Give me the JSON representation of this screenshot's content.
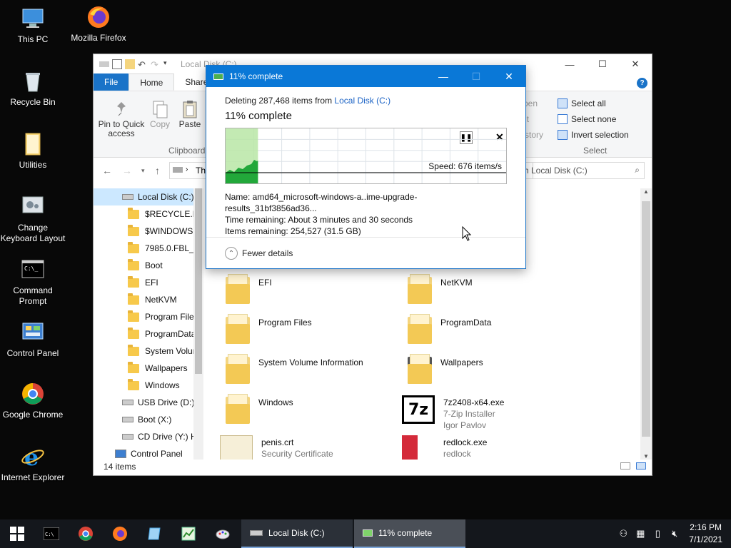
{
  "desktop": {
    "icons": [
      {
        "label": "This PC"
      },
      {
        "label": "Mozilla Firefox"
      },
      {
        "label": "Recycle Bin"
      },
      {
        "label": "Utilities"
      },
      {
        "label": "Change Keyboard Layout"
      },
      {
        "label": "Command Prompt"
      },
      {
        "label": "Control Panel"
      },
      {
        "label": "Google Chrome"
      },
      {
        "label": "Internet Explorer"
      }
    ]
  },
  "explorer": {
    "title": "Local Disk (C:)",
    "tabs": [
      "File",
      "Home",
      "Share"
    ],
    "ribbon": {
      "pin": "Pin to Quick access",
      "copy": "Copy",
      "paste": "Paste",
      "clipboard": "Clipboard",
      "open_partial": "pen",
      "edit_partial": "it",
      "history_partial": "story",
      "select_all": "Select all",
      "select_none": "Select none",
      "invert_selection": "Invert selection",
      "select_group": "Select"
    },
    "address": "Th",
    "search_placeholder": "h Local Disk (C:)",
    "tree": [
      {
        "label": "Local Disk (C:)",
        "type": "drive"
      },
      {
        "label": "$RECYCLE.BIN",
        "type": "folder"
      },
      {
        "label": "$WINDOWS.~",
        "type": "folder"
      },
      {
        "label": "7985.0.FBL_GI",
        "type": "folder"
      },
      {
        "label": "Boot",
        "type": "folder"
      },
      {
        "label": "EFI",
        "type": "folder"
      },
      {
        "label": "NetKVM",
        "type": "folder"
      },
      {
        "label": "Program Files",
        "type": "folder"
      },
      {
        "label": "ProgramData",
        "type": "folder"
      },
      {
        "label": "System Volun",
        "type": "folder"
      },
      {
        "label": "Wallpapers",
        "type": "folder"
      },
      {
        "label": "Windows",
        "type": "folder"
      },
      {
        "label": "USB Drive (D:)",
        "type": "drive"
      },
      {
        "label": "Boot (X:)",
        "type": "drive"
      },
      {
        "label": "CD Drive (Y:) H",
        "type": "drive"
      },
      {
        "label": "Control Panel",
        "type": "cp"
      }
    ],
    "files": [
      {
        "name": "EFI",
        "sub1": "",
        "sub2": ""
      },
      {
        "name": "NetKVM",
        "sub1": "",
        "sub2": ""
      },
      {
        "name": "Program Files",
        "sub1": "",
        "sub2": ""
      },
      {
        "name": "ProgramData",
        "sub1": "",
        "sub2": ""
      },
      {
        "name": "System Volume Information",
        "sub1": "",
        "sub2": ""
      },
      {
        "name": "Wallpapers",
        "sub1": "",
        "sub2": ""
      },
      {
        "name": "Windows",
        "sub1": "",
        "sub2": ""
      },
      {
        "name": "7z2408-x64.exe",
        "sub1": "7-Zip Installer",
        "sub2": "Igor Pavlov"
      },
      {
        "name": "penis.crt",
        "sub1": "Security Certificate",
        "sub2": ""
      },
      {
        "name": "redlock.exe",
        "sub1": "redlock",
        "sub2": ""
      }
    ],
    "status": "14 items"
  },
  "dialog": {
    "title": "11% complete",
    "deleting_prefix": "Deleting 287,468 items from ",
    "source": "Local Disk (C:)",
    "headline": "11% complete",
    "progress": 0.11,
    "speed": "Speed: 676 items/s",
    "name_line": "Name:  amd64_microsoft-windows-a..ime-upgrade-results_31bf3856ad36...",
    "time_line": "Time remaining:  About 3 minutes and 30 seconds",
    "items_line": "Items remaining:  254,527 (31.5 GB)",
    "fewer_details": "Fewer details"
  },
  "taskbar": {
    "task1": "Local Disk (C:)",
    "task2": "11% complete",
    "time": "2:16 PM",
    "date": "7/1/2021"
  }
}
